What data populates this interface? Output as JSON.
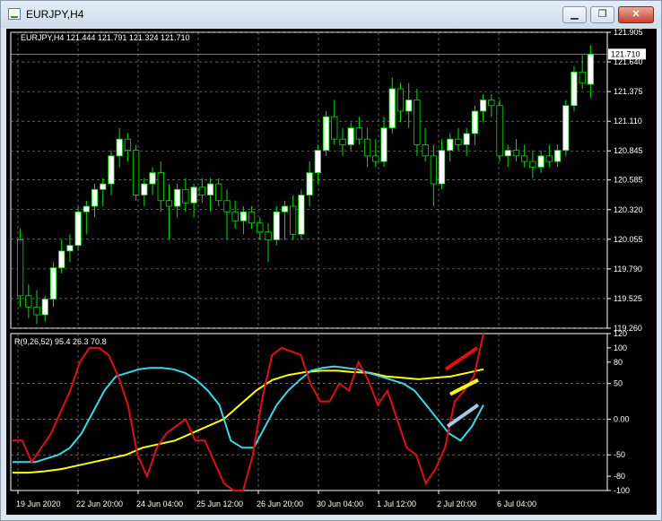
{
  "window": {
    "title": "EURJPY,H4",
    "minimize_glyph": "▁",
    "restore_glyph": "❐",
    "close_glyph": "✕"
  },
  "main_chart": {
    "header": "EURJPY,H4  121.444 121.791 121.324 121.710",
    "price_labels": [
      "121.905",
      "121.640",
      "121.375",
      "121.110",
      "120.845",
      "120.585",
      "120.320",
      "120.055",
      "119.790",
      "119.525",
      "119.260"
    ],
    "current_price": "121.710",
    "bull_color": "#ffffff",
    "bear_color": "#000000",
    "wick_color": "#00e000"
  },
  "indicator": {
    "header": "R(9,26,52) 95.4 26.3 70.8",
    "labels": [
      "120",
      "100",
      "80",
      "50",
      "0.00",
      "-50",
      "-80",
      "-100"
    ],
    "series_colors": {
      "fast": "#e01010",
      "medium": "#3cd8e8",
      "slow": "#ffff00"
    }
  },
  "time_axis": [
    "19 Jun 2020",
    "22 Jun 20:00",
    "24 Jun 04:00",
    "25 Jun 12:00",
    "26 Jun 20:00",
    "30 Jun 04:00",
    "1 Jul 12:00",
    "2 Jul 20:00",
    "6 Jul 04:00"
  ],
  "chart_data": {
    "type": "candlestick",
    "candles": [
      {
        "o": 120.05,
        "h": 120.15,
        "l": 119.45,
        "c": 119.55
      },
      {
        "o": 119.55,
        "h": 119.65,
        "l": 119.35,
        "c": 119.45
      },
      {
        "o": 119.45,
        "h": 119.6,
        "l": 119.3,
        "c": 119.38
      },
      {
        "o": 119.38,
        "h": 119.55,
        "l": 119.32,
        "c": 119.52
      },
      {
        "o": 119.52,
        "h": 119.85,
        "l": 119.45,
        "c": 119.8
      },
      {
        "o": 119.8,
        "h": 120.05,
        "l": 119.75,
        "c": 119.95
      },
      {
        "o": 119.95,
        "h": 120.1,
        "l": 119.85,
        "c": 120.0
      },
      {
        "o": 120.0,
        "h": 120.35,
        "l": 119.95,
        "c": 120.3
      },
      {
        "o": 120.3,
        "h": 120.4,
        "l": 120.1,
        "c": 120.35
      },
      {
        "o": 120.35,
        "h": 120.55,
        "l": 120.25,
        "c": 120.5
      },
      {
        "o": 120.5,
        "h": 120.6,
        "l": 120.35,
        "c": 120.55
      },
      {
        "o": 120.55,
        "h": 120.85,
        "l": 120.45,
        "c": 120.8
      },
      {
        "o": 120.8,
        "h": 121.05,
        "l": 120.7,
        "c": 120.95
      },
      {
        "o": 120.95,
        "h": 121.0,
        "l": 120.75,
        "c": 120.85
      },
      {
        "o": 120.85,
        "h": 120.9,
        "l": 120.4,
        "c": 120.45
      },
      {
        "o": 120.45,
        "h": 120.6,
        "l": 120.35,
        "c": 120.55
      },
      {
        "o": 120.55,
        "h": 120.7,
        "l": 120.45,
        "c": 120.65
      },
      {
        "o": 120.65,
        "h": 120.75,
        "l": 120.3,
        "c": 120.4
      },
      {
        "o": 120.4,
        "h": 120.55,
        "l": 120.05,
        "c": 120.35
      },
      {
        "o": 120.35,
        "h": 120.55,
        "l": 120.25,
        "c": 120.5
      },
      {
        "o": 120.5,
        "h": 120.6,
        "l": 120.3,
        "c": 120.38
      },
      {
        "o": 120.38,
        "h": 120.55,
        "l": 120.25,
        "c": 120.52
      },
      {
        "o": 120.52,
        "h": 120.6,
        "l": 120.38,
        "c": 120.45
      },
      {
        "o": 120.45,
        "h": 120.6,
        "l": 120.3,
        "c": 120.55
      },
      {
        "o": 120.55,
        "h": 120.6,
        "l": 120.35,
        "c": 120.4
      },
      {
        "o": 120.4,
        "h": 120.5,
        "l": 120.05,
        "c": 120.3
      },
      {
        "o": 120.3,
        "h": 120.4,
        "l": 120.15,
        "c": 120.22
      },
      {
        "o": 120.22,
        "h": 120.35,
        "l": 120.1,
        "c": 120.3
      },
      {
        "o": 120.3,
        "h": 120.35,
        "l": 120.15,
        "c": 120.2
      },
      {
        "o": 120.2,
        "h": 120.25,
        "l": 120.05,
        "c": 120.12
      },
      {
        "o": 120.12,
        "h": 120.2,
        "l": 119.85,
        "c": 120.05
      },
      {
        "o": 120.05,
        "h": 120.35,
        "l": 120.0,
        "c": 120.3
      },
      {
        "o": 120.3,
        "h": 120.4,
        "l": 120.05,
        "c": 120.35
      },
      {
        "o": 120.35,
        "h": 120.45,
        "l": 120.05,
        "c": 120.1
      },
      {
        "o": 120.1,
        "h": 120.5,
        "l": 120.05,
        "c": 120.45
      },
      {
        "o": 120.45,
        "h": 120.75,
        "l": 120.35,
        "c": 120.65
      },
      {
        "o": 120.65,
        "h": 120.9,
        "l": 120.55,
        "c": 120.85
      },
      {
        "o": 120.85,
        "h": 121.2,
        "l": 120.8,
        "c": 121.15
      },
      {
        "o": 121.15,
        "h": 121.3,
        "l": 120.9,
        "c": 120.95
      },
      {
        "o": 120.95,
        "h": 121.05,
        "l": 120.8,
        "c": 120.9
      },
      {
        "o": 120.9,
        "h": 121.1,
        "l": 120.85,
        "c": 121.05
      },
      {
        "o": 121.05,
        "h": 121.15,
        "l": 120.9,
        "c": 120.95
      },
      {
        "o": 120.95,
        "h": 121.05,
        "l": 120.7,
        "c": 120.8
      },
      {
        "o": 120.8,
        "h": 120.95,
        "l": 120.7,
        "c": 120.75
      },
      {
        "o": 120.75,
        "h": 121.15,
        "l": 120.7,
        "c": 121.05
      },
      {
        "o": 121.05,
        "h": 121.5,
        "l": 121.0,
        "c": 121.4
      },
      {
        "o": 121.4,
        "h": 121.45,
        "l": 121.1,
        "c": 121.2
      },
      {
        "o": 121.2,
        "h": 121.45,
        "l": 121.05,
        "c": 121.3
      },
      {
        "o": 121.3,
        "h": 121.4,
        "l": 120.8,
        "c": 120.9
      },
      {
        "o": 120.9,
        "h": 121.05,
        "l": 120.75,
        "c": 120.8
      },
      {
        "o": 120.8,
        "h": 120.9,
        "l": 120.35,
        "c": 120.55
      },
      {
        "o": 120.55,
        "h": 120.95,
        "l": 120.5,
        "c": 120.85
      },
      {
        "o": 120.85,
        "h": 121.0,
        "l": 120.75,
        "c": 120.95
      },
      {
        "o": 120.95,
        "h": 121.05,
        "l": 120.85,
        "c": 120.9
      },
      {
        "o": 120.9,
        "h": 121.05,
        "l": 120.8,
        "c": 121.0
      },
      {
        "o": 121.0,
        "h": 121.25,
        "l": 120.9,
        "c": 121.2
      },
      {
        "o": 121.2,
        "h": 121.35,
        "l": 121.1,
        "c": 121.3
      },
      {
        "o": 121.3,
        "h": 121.35,
        "l": 121.15,
        "c": 121.25
      },
      {
        "o": 121.25,
        "h": 121.3,
        "l": 120.75,
        "c": 120.8
      },
      {
        "o": 120.8,
        "h": 120.9,
        "l": 120.7,
        "c": 120.85
      },
      {
        "o": 120.85,
        "h": 120.95,
        "l": 120.75,
        "c": 120.8
      },
      {
        "o": 120.8,
        "h": 120.9,
        "l": 120.7,
        "c": 120.75
      },
      {
        "o": 120.75,
        "h": 120.85,
        "l": 120.6,
        "c": 120.7
      },
      {
        "o": 120.7,
        "h": 120.85,
        "l": 120.65,
        "c": 120.8
      },
      {
        "o": 120.8,
        "h": 120.9,
        "l": 120.7,
        "c": 120.75
      },
      {
        "o": 120.75,
        "h": 120.9,
        "l": 120.7,
        "c": 120.85
      },
      {
        "o": 120.85,
        "h": 121.3,
        "l": 120.8,
        "c": 121.25
      },
      {
        "o": 121.25,
        "h": 121.6,
        "l": 121.2,
        "c": 121.55
      },
      {
        "o": 121.55,
        "h": 121.7,
        "l": 121.4,
        "c": 121.45
      },
      {
        "o": 121.44,
        "h": 121.79,
        "l": 121.32,
        "c": 121.71
      }
    ],
    "price_range": [
      119.26,
      121.905
    ],
    "indicator_range": [
      -100,
      120
    ],
    "indicator_series": {
      "fast": [
        -30,
        -30,
        -60,
        -40,
        -20,
        10,
        40,
        80,
        100,
        100,
        90,
        60,
        20,
        -50,
        -80,
        -40,
        -20,
        -10,
        0,
        -30,
        -30,
        -60,
        -90,
        -100,
        -100,
        -50,
        30,
        90,
        100,
        95,
        90,
        50,
        25,
        25,
        50,
        40,
        80,
        55,
        20,
        40,
        0,
        -40,
        -50,
        -90,
        -70,
        -40,
        25,
        40,
        60,
        120
      ],
      "medium": [
        -60,
        -60,
        -60,
        -55,
        -50,
        -40,
        -20,
        10,
        40,
        60,
        65,
        70,
        72,
        72,
        70,
        65,
        55,
        40,
        20,
        -30,
        -40,
        -40,
        -10,
        20,
        40,
        55,
        68,
        72,
        74,
        72,
        70,
        65,
        60,
        55,
        50,
        40,
        20,
        0,
        -20,
        -30,
        -10,
        20
      ],
      "slow": [
        -75,
        -75,
        -73,
        -70,
        -65,
        -60,
        -55,
        -50,
        -40,
        -35,
        -30,
        -20,
        -10,
        0,
        20,
        40,
        55,
        62,
        66,
        68,
        68,
        66,
        65,
        60,
        58,
        56,
        58,
        60,
        65,
        70
      ]
    },
    "xlabel": "",
    "ylabel": ""
  }
}
